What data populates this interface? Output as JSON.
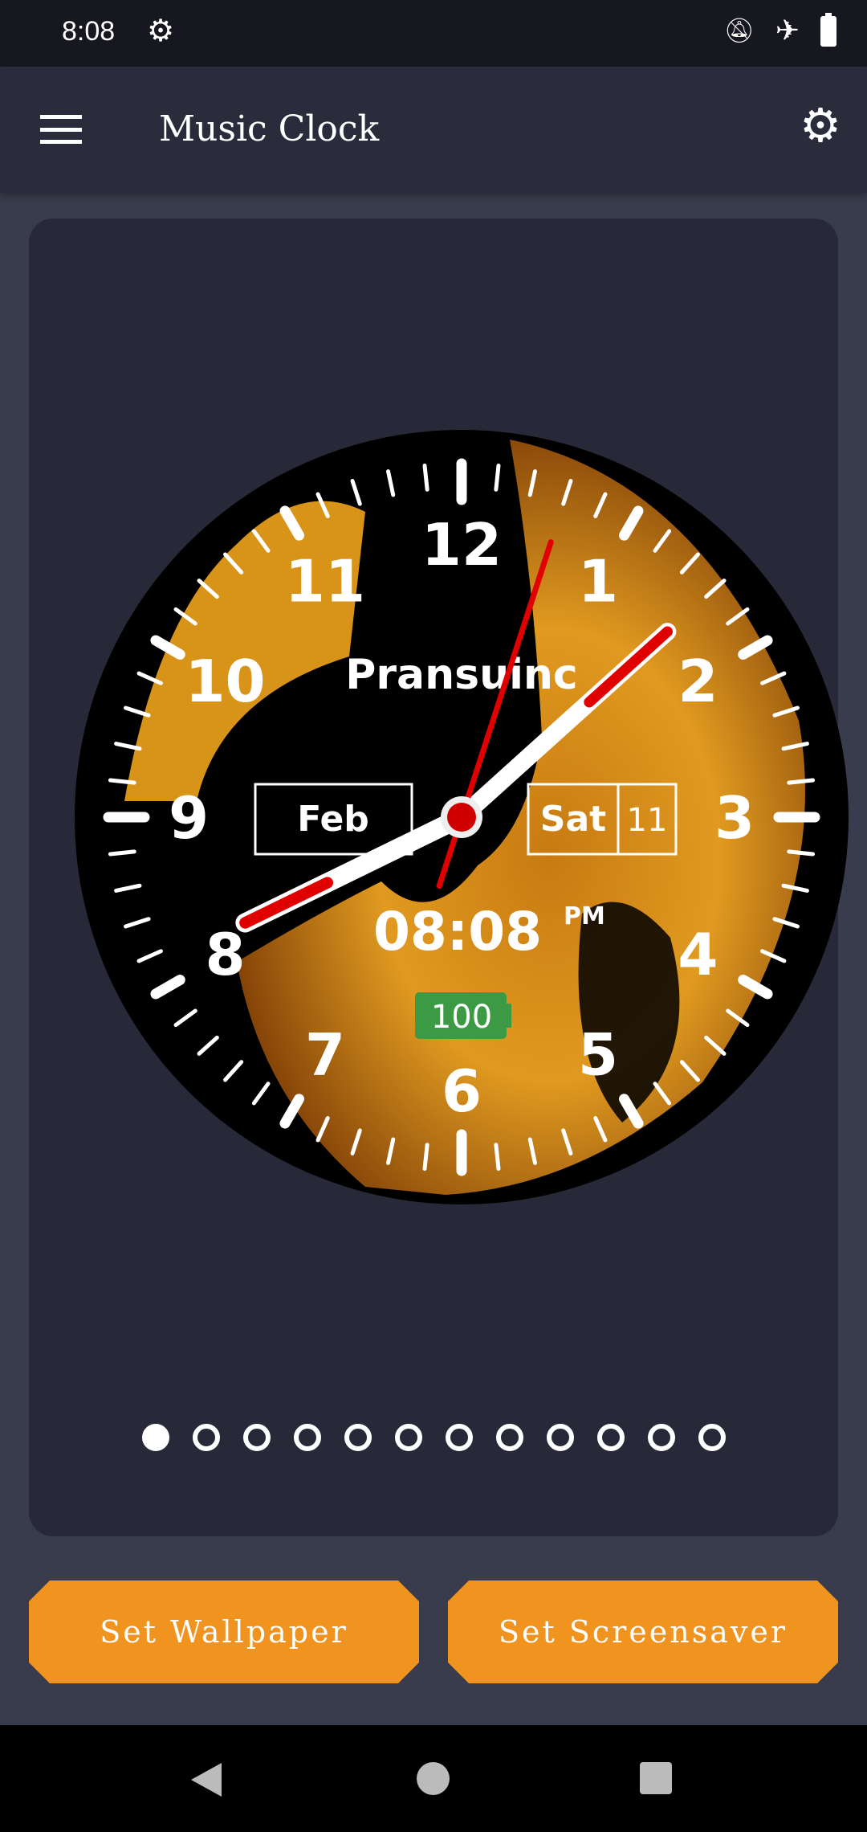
{
  "status_bar": {
    "time": "8:08",
    "icons": [
      "settings-icon",
      "notifications-off-icon",
      "airplane-mode-icon",
      "battery-full-icon"
    ]
  },
  "toolbar": {
    "title": "Music Clock",
    "menu_icon": "hamburger-menu-icon",
    "settings_icon": "gear-icon"
  },
  "clock": {
    "brand": "Pransuinc",
    "month": "Feb",
    "weekday": "Sat",
    "day": "11",
    "digital_time": "08:08",
    "ampm": "PM",
    "battery": "100",
    "numbers": [
      "12",
      "1",
      "2",
      "3",
      "4",
      "5",
      "6",
      "7",
      "8",
      "9",
      "10",
      "11"
    ],
    "hands": {
      "hour": 8,
      "minute": 8,
      "second": 3
    },
    "colors": {
      "hand": "#ffffff",
      "hand_tip": "#e00000",
      "battery": "#3c9a45"
    }
  },
  "pager": {
    "count": 12,
    "active": 0
  },
  "buttons": {
    "wallpaper": "Set Wallpaper",
    "screensaver": "Set Screensaver"
  },
  "colors": {
    "accent": "#f0931f",
    "card": "#272938",
    "background": "#393c4d"
  }
}
